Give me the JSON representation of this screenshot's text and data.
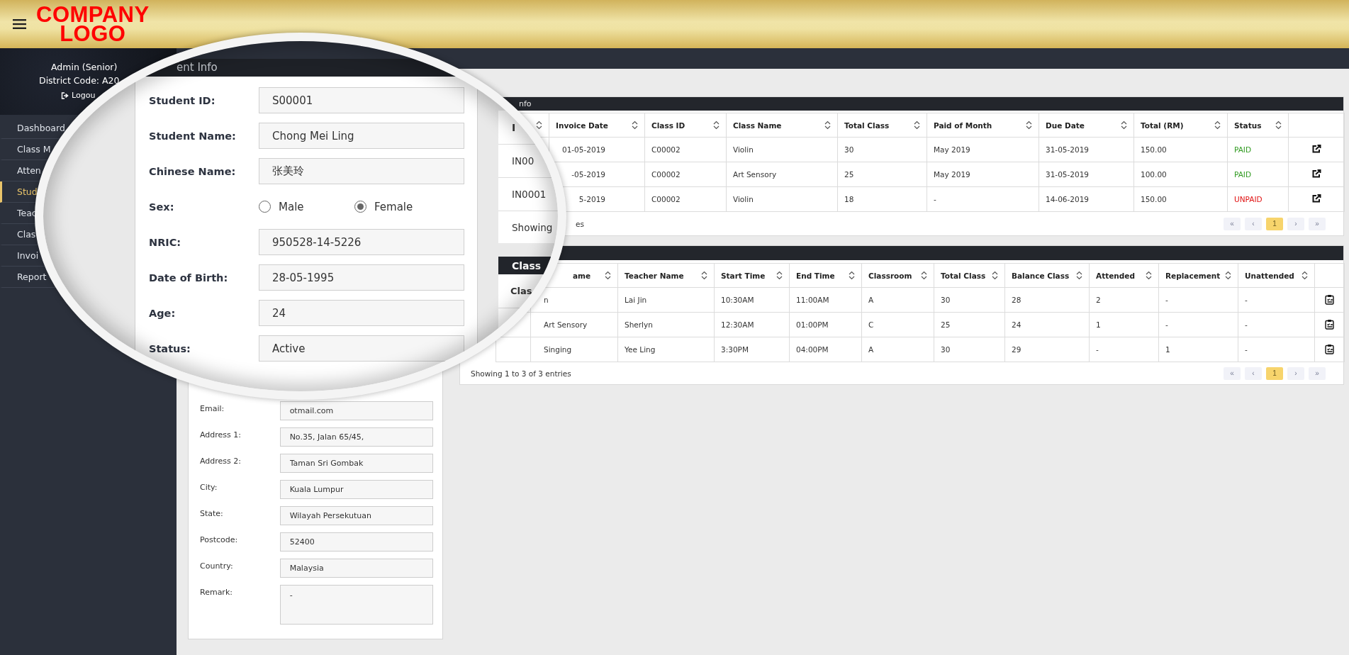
{
  "header": {
    "logo": [
      "COMPANY",
      "LOGO"
    ]
  },
  "sidebar": {
    "user_role": "Admin (Senior)",
    "district_code": "District Code: A20",
    "logout": "Logou",
    "items": [
      {
        "label": "Dashboard",
        "selected": false
      },
      {
        "label": "Class M",
        "selected": false
      },
      {
        "label": "Atten",
        "selected": false
      },
      {
        "label": "Stud",
        "selected": true
      },
      {
        "label": "Teac",
        "selected": false
      },
      {
        "label": "Clas",
        "selected": false
      },
      {
        "label": "Invoi",
        "selected": false
      },
      {
        "label": "Report",
        "selected": false
      }
    ]
  },
  "student_info": {
    "fields": [
      {
        "label": "Email:",
        "value": "otmail.com",
        "kind": "input"
      },
      {
        "label": "Address 1:",
        "value": "No.35, Jalan 65/45,",
        "kind": "input"
      },
      {
        "label": "Address 2:",
        "value": "Taman Sri Gombak",
        "kind": "input"
      },
      {
        "label": "City:",
        "value": "Kuala Lumpur",
        "kind": "input"
      },
      {
        "label": "State:",
        "value": "Wilayah Persekutuan",
        "kind": "input"
      },
      {
        "label": "Postcode:",
        "value": "52400",
        "kind": "input"
      },
      {
        "label": "Country:",
        "value": "Malaysia",
        "kind": "input"
      },
      {
        "label": "Remark:",
        "value": "-",
        "kind": "textarea"
      }
    ]
  },
  "invoice": {
    "title": "nfo",
    "columns": [
      "Invoice Date",
      "Class ID",
      "Class Name",
      "Total Class",
      "Paid of Month",
      "Due Date",
      "Total (RM)",
      "Status"
    ],
    "rows": [
      {
        "cells": [
          "01-05-2019",
          "C00002",
          "Violin",
          "30",
          "May 2019",
          "31-05-2019",
          "150.00"
        ],
        "status": "PAID",
        "paid": true
      },
      {
        "cells": [
          "-05-2019",
          "C00002",
          "Art Sensory",
          "25",
          "May 2019",
          "31-05-2019",
          "100.00"
        ],
        "status": "PAID",
        "paid": true
      },
      {
        "cells": [
          "5-2019",
          "C00002",
          "Violin",
          "18",
          "-",
          "14-06-2019",
          "150.00"
        ],
        "status": "UNPAID",
        "paid": false
      }
    ],
    "footer": "es",
    "pagination": [
      {
        "label": "«",
        "selected": false
      },
      {
        "label": "‹",
        "selected": false
      },
      {
        "label": "1",
        "selected": true
      },
      {
        "label": "›",
        "selected": false
      },
      {
        "label": "»",
        "selected": false
      }
    ]
  },
  "classes": {
    "columns": [
      "ame",
      "Teacher Name",
      "Start Time",
      "End Time",
      "Classroom",
      "Total Class",
      "Balance Class",
      "Attended",
      "Replacement",
      "Unattended"
    ],
    "rows": [
      {
        "cells": [
          "n",
          "Lai Jin",
          "10:30AM",
          "11:00AM",
          "A",
          "30",
          "28",
          "2",
          "-",
          "-"
        ]
      },
      {
        "cells": [
          "Art Sensory",
          "Sherlyn",
          "12:30AM",
          "01:00PM",
          "C",
          "25",
          "24",
          "1",
          "-",
          "-"
        ]
      },
      {
        "cells": [
          "Singing",
          "Yee Ling",
          "3:30PM",
          "04:00PM",
          "A",
          "30",
          "29",
          "-",
          "1",
          "-"
        ]
      }
    ],
    "footer": "Showing 1 to 3 of 3 entries",
    "pagination": [
      {
        "label": "«",
        "selected": false
      },
      {
        "label": "‹",
        "selected": false
      },
      {
        "label": "1",
        "selected": true
      },
      {
        "label": "›",
        "selected": false
      },
      {
        "label": "»",
        "selected": false
      }
    ]
  },
  "magnifier": {
    "panel_title": "ent Info",
    "fields": [
      {
        "label": "Student ID:",
        "kind": "input",
        "value": "S00001"
      },
      {
        "label": "Student Name:",
        "kind": "input",
        "value": "Chong Mei Ling"
      },
      {
        "label": "Chinese Name:",
        "kind": "input",
        "value": "张美玲"
      },
      {
        "label": "Sex:",
        "kind": "radio",
        "options": [
          {
            "label": "Male",
            "selected": false
          },
          {
            "label": "Female",
            "selected": true
          }
        ]
      },
      {
        "label": "NRIC:",
        "kind": "input",
        "value": "950528-14-5226"
      },
      {
        "label": "Date of Birth:",
        "kind": "input",
        "value": "28-05-1995"
      },
      {
        "label": "Age:",
        "kind": "input",
        "value": "24"
      },
      {
        "label": "Status:",
        "kind": "input",
        "value": "Active"
      }
    ],
    "invoice_fragment": {
      "header": "I",
      "rows": [
        "IN00",
        "IN0001"
      ],
      "footer": "Showing"
    },
    "class_fragment": {
      "title": "Class",
      "header": "Clas"
    }
  }
}
